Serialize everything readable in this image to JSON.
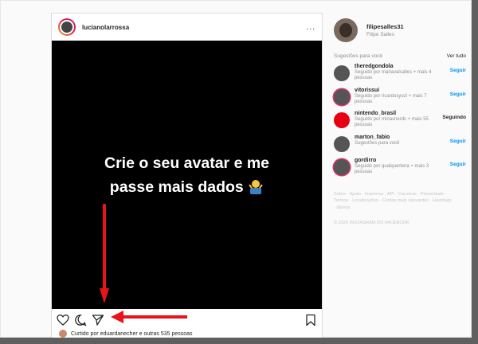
{
  "post": {
    "username": "lucianolarrossa",
    "more": "...",
    "media_line1": "Crie o seu avatar e me",
    "media_line2": "passe mais dados",
    "likes_text": "Curtido por eduardanecher e outras 535 pessoas"
  },
  "profile": {
    "username": "filipesalles31",
    "full_name": "Filipe Salles"
  },
  "suggestions": {
    "title": "Sugestões para você",
    "see_all": "Ver tudo",
    "items": [
      {
        "name": "theredgondola",
        "sub": "Seguido por mariavalsalles + mais 4 pessoas",
        "action": "Seguir"
      },
      {
        "name": "vitorissui",
        "sub": "Seguido por ricardosyozi + mais 7 pessoas",
        "action": "Seguir"
      },
      {
        "name": "nintendo_brasil",
        "sub": "Seguido por minasnerds + mais 55 pessoas",
        "action": "Seguindo"
      },
      {
        "name": "marton_fabio",
        "sub": "Sugestões para você",
        "action": "Seguir"
      },
      {
        "name": "gordirro",
        "sub": "Seguido por qualquerlena + mais 3 pessoas",
        "action": "Seguir"
      }
    ]
  },
  "footer": {
    "links": "Sobre · Ajuda · Imprensa · API · Carreiras · Privacidade · Termos · Localizações · Contas mais relevantes · Hashtags · Idioma",
    "copyright": "© 2020 INSTAGRAM DO FACEBOOK"
  },
  "colors": {
    "accent": "#0095f6",
    "annotation_arrow": "#e8141a"
  },
  "icons": [
    "heart-icon",
    "comment-icon",
    "share-icon",
    "bookmark-icon",
    "more-icon",
    "shrug-emoji"
  ]
}
